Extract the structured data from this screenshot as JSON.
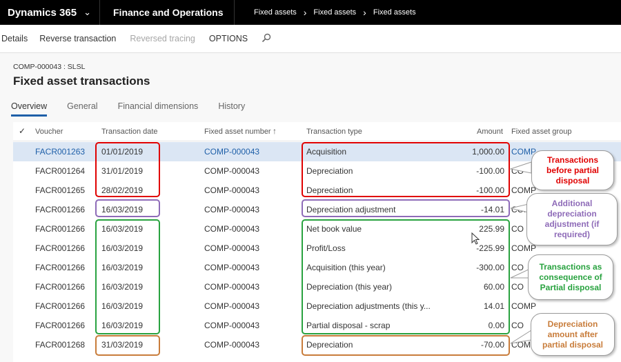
{
  "topbar": {
    "brand": "Dynamics 365",
    "app": "Finance and Operations",
    "breadcrumbs": [
      "Fixed assets",
      "Fixed assets",
      "Fixed assets"
    ]
  },
  "actions": {
    "details": "Details",
    "reverse": "Reverse transaction",
    "reversed_tracing": "Reversed tracing",
    "options": "OPTIONS"
  },
  "page": {
    "record_id": "COMP-000043 : SLSL",
    "title": "Fixed asset transactions"
  },
  "tabs": [
    "Overview",
    "General",
    "Financial dimensions",
    "History"
  ],
  "grid": {
    "columns": {
      "check": "✓",
      "voucher": "Voucher",
      "date": "Transaction date",
      "asset": "Fixed asset number",
      "sort_arrow": "↑",
      "type": "Transaction type",
      "amount": "Amount",
      "group": "Fixed asset group"
    },
    "rows": [
      {
        "voucher": "FACR001263",
        "date": "01/01/2019",
        "asset": "COMP-000043",
        "type": "Acquisition",
        "amount": "1,000.00",
        "group": "COMP"
      },
      {
        "voucher": "FACR001264",
        "date": "31/01/2019",
        "asset": "COMP-000043",
        "type": "Depreciation",
        "amount": "-100.00",
        "group": "CO"
      },
      {
        "voucher": "FACR001265",
        "date": "28/02/2019",
        "asset": "COMP-000043",
        "type": "Depreciation",
        "amount": "-100.00",
        "group": "COMP"
      },
      {
        "voucher": "FACR001266",
        "date": "16/03/2019",
        "asset": "COMP-000043",
        "type": "Depreciation adjustment",
        "amount": "-14.01",
        "group": "COMP"
      },
      {
        "voucher": "FACR001266",
        "date": "16/03/2019",
        "asset": "COMP-000043",
        "type": "Net book value",
        "amount": "225.99",
        "group": "CO"
      },
      {
        "voucher": "FACR001266",
        "date": "16/03/2019",
        "asset": "COMP-000043",
        "type": "Profit/Loss",
        "amount": "-225.99",
        "group": "COMP"
      },
      {
        "voucher": "FACR001266",
        "date": "16/03/2019",
        "asset": "COMP-000043",
        "type": "Acquisition (this year)",
        "amount": "-300.00",
        "group": "CO"
      },
      {
        "voucher": "FACR001266",
        "date": "16/03/2019",
        "asset": "COMP-000043",
        "type": "Depreciation (this year)",
        "amount": "60.00",
        "group": "CO"
      },
      {
        "voucher": "FACR001266",
        "date": "16/03/2019",
        "asset": "COMP-000043",
        "type": "Depreciation adjustments (this y...",
        "amount": "14.01",
        "group": "COMP"
      },
      {
        "voucher": "FACR001266",
        "date": "16/03/2019",
        "asset": "COMP-000043",
        "type": "Partial disposal - scrap",
        "amount": "0.00",
        "group": "CO"
      },
      {
        "voucher": "FACR001268",
        "date": "31/03/2019",
        "asset": "COMP-000043",
        "type": "Depreciation",
        "amount": "-70.00",
        "group": "COMP"
      }
    ]
  },
  "callouts": {
    "before": "Transactions before partial disposal",
    "additional": "Additional depreciation adjustment (if required)",
    "consequence": "Transactions as consequence of Partial disposal",
    "after": "Depreciation amount after partial disposal"
  },
  "colors": {
    "red": "#e00000",
    "purple": "#8e6bb8",
    "green": "#28a23f",
    "orange": "#c87c3a",
    "link": "#1e5fa8"
  }
}
